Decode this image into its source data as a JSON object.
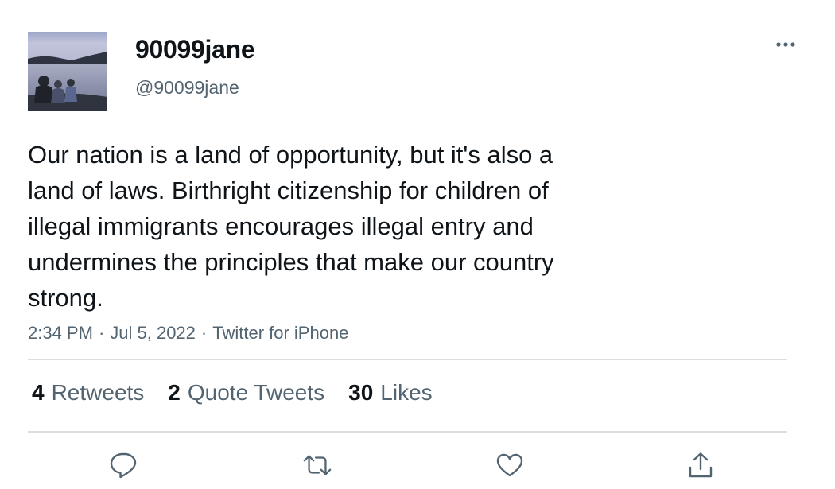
{
  "author": {
    "display_name": "90099jane",
    "handle": "@90099jane",
    "avatar_icon": "profile-photo-lake-scene"
  },
  "tweet": {
    "text_lines": [
      "Our nation is a land of opportunity, but it's also a",
      "land of laws. Birthright citizenship for children of",
      "illegal immigrants encourages illegal entry and",
      "undermines the principles that make our country",
      "strong."
    ],
    "time": "2:34 PM",
    "date": "Jul 5, 2022",
    "source": "Twitter for iPhone",
    "separator": "·"
  },
  "stats": {
    "retweets": {
      "count": "4",
      "label": "Retweets"
    },
    "quotes": {
      "count": "2",
      "label": "Quote Tweets"
    },
    "likes": {
      "count": "30",
      "label": "Likes"
    }
  },
  "actions": {
    "icons": [
      "reply-icon",
      "retweet-icon",
      "like-icon",
      "share-icon"
    ],
    "icon_color": "#536471"
  },
  "colors": {
    "text": "#0f1419",
    "secondary": "#536471",
    "divider": "#dcdfe2"
  }
}
